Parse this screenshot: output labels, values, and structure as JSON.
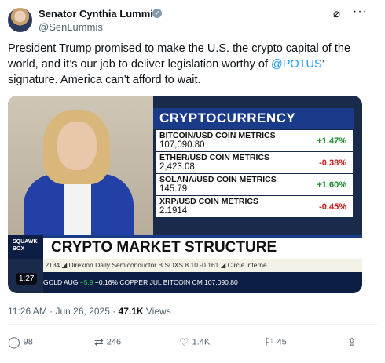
{
  "author": {
    "name": "Senator Cynthia Lummis",
    "handle": "@SenLummis",
    "verified_icon": "✓"
  },
  "header_icons": {
    "grok": "⌀",
    "more": "···"
  },
  "tweet": {
    "text_before": "President Trump promised to make the U.S. the crypto capital of the world, and it’s our job to deliver legislation worthy of ",
    "mention": "@POTUS",
    "text_after": "’ signature. America can’t afford to wait."
  },
  "media": {
    "panel_title": "CRYPTOCURRENCY",
    "metrics": [
      {
        "label": "BITCOIN/USD COIN METRICS",
        "price": "107,090.80",
        "change": "+1.47%",
        "direction": "up"
      },
      {
        "label": "ETHER/USD COIN METRICS",
        "price": "2,423.08",
        "change": "-0.38%",
        "direction": "down"
      },
      {
        "label": "SOLANA/USD COIN METRICS",
        "price": "145.79",
        "change": "+1.60%",
        "direction": "up"
      },
      {
        "label": "XRP/USD COIN METRICS",
        "price": "2.1914",
        "change": "-0.45%",
        "direction": "down"
      }
    ],
    "show_label": "SQUAWK BOX",
    "banner": "CRYPTO MARKET STRUCTURE",
    "ticker1": ".2134 ◢  Direxion Daily Semiconductor B SOXS 8.10 -0.161 ◢   Circle interne",
    "ticker2_a": "GOLD AUG  ",
    "ticker2_b": "+5.9",
    "ticker2_c": " +0.16%   COPPER JUL      BITCOIN CM  107,090.80",
    "duration": "1:27"
  },
  "meta": {
    "time": "11:26 AM · Jun 26, 2025 · ",
    "views_count": "47.1K",
    "views_label": " Views"
  },
  "actions": [
    {
      "icon": "reply-icon",
      "glyph": "◯",
      "count": "98"
    },
    {
      "icon": "retweet-icon",
      "glyph": "⇄",
      "count": "246"
    },
    {
      "icon": "like-icon",
      "glyph": "♡",
      "count": "1.4K"
    },
    {
      "icon": "bookmark-icon",
      "glyph": "⚐",
      "count": "45"
    },
    {
      "icon": "share-icon",
      "glyph": "⇪",
      "count": ""
    }
  ]
}
